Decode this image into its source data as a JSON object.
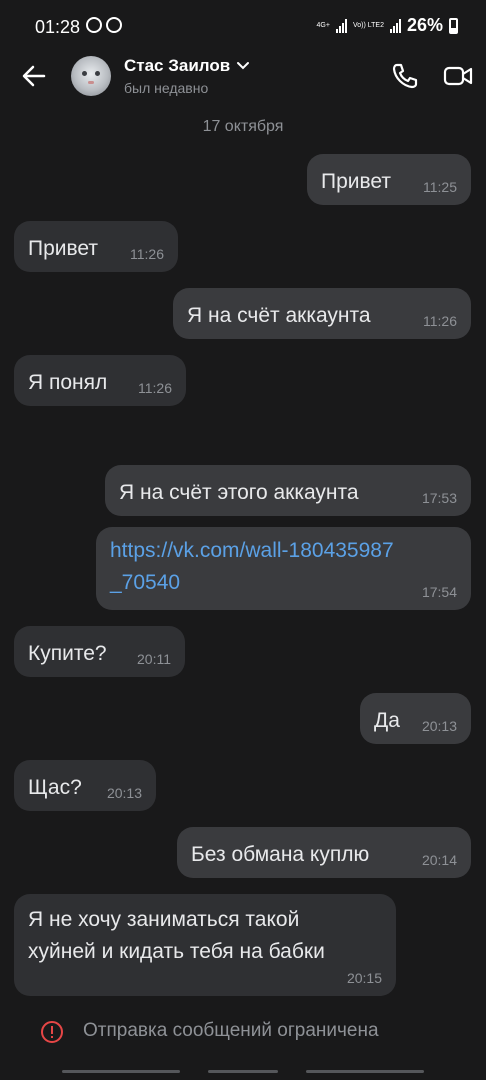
{
  "status_bar": {
    "time": "01:28",
    "battery": "26%",
    "net1": "4G+",
    "net2": "Vo)) LTE2"
  },
  "header": {
    "name": "Стас Заилов",
    "status": "был недавно"
  },
  "date_separator": "17 октября",
  "messages": [
    {
      "text": "Привет",
      "time": "11:25",
      "direction": "out"
    },
    {
      "text": "Привет",
      "time": "11:26",
      "direction": "in"
    },
    {
      "text": "Я на счёт аккаунта",
      "time": "11:26",
      "direction": "out"
    },
    {
      "text": "Я понял",
      "time": "11:26",
      "direction": "in"
    },
    {
      "text": "Я на счёт этого аккаунта",
      "time": "17:53",
      "direction": "out"
    },
    {
      "text_line1": "https://vk.com/wall-180435987",
      "text_line2": "_70540",
      "time": "17:54",
      "direction": "out"
    },
    {
      "text": "Купите?",
      "time": "20:11",
      "direction": "in"
    },
    {
      "text": "Да",
      "time": "20:13",
      "direction": "out"
    },
    {
      "text": "Щас?",
      "time": "20:13",
      "direction": "in"
    },
    {
      "text": "Без обмана куплю",
      "time": "20:14",
      "direction": "out"
    },
    {
      "text_line1": "Я не хочу заниматься такой",
      "text_line2": "хуйней и кидать тебя на бабки",
      "time": "20:15",
      "direction": "in"
    }
  ],
  "footer": {
    "notice": "Отправка сообщений ограничена"
  },
  "colors": {
    "background": "#19191a",
    "bubble": "#2f3033",
    "link": "#5ba1e6",
    "warning": "#e64646"
  },
  "icons": [
    "back-arrow-icon",
    "chevron-down-icon",
    "phone-icon",
    "video-camera-icon",
    "warning-icon"
  ]
}
